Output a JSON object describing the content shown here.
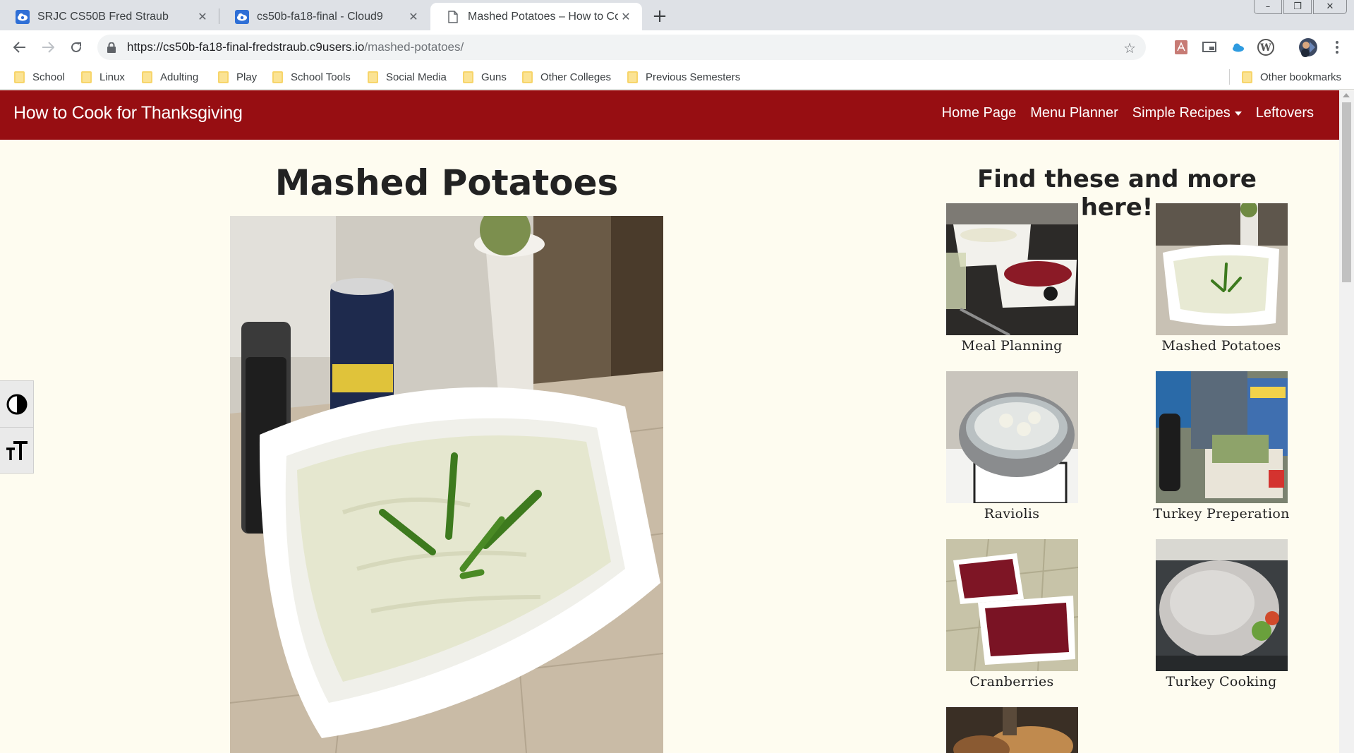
{
  "browser": {
    "tabs": [
      {
        "title": "SRJC CS50B Fred Straub",
        "icon": "cloud9-icon"
      },
      {
        "title": "cs50b-fa18-final - Cloud9",
        "icon": "cloud9-icon"
      },
      {
        "title": "Mashed Potatoes – How to Cook",
        "icon": "document-icon"
      }
    ],
    "url_host": "https://cs50b-fa18-final-fredstraub.c9users.io",
    "url_path": "/mashed-potatoes/",
    "bookmarks": [
      "School",
      "Linux",
      "Adulting",
      "Play",
      "School Tools",
      "Social Media",
      "Guns",
      "Other Colleges",
      "Previous Semesters"
    ],
    "other_bookmarks": "Other bookmarks"
  },
  "site": {
    "brand": "How to Cook for Thanksgiving",
    "nav": {
      "home": "Home Page",
      "menu_planner": "Menu Planner",
      "simple_recipes": "Simple Recipes",
      "leftovers": "Leftovers"
    },
    "accent_color": "#970e12",
    "background_color": "#fefcf0"
  },
  "main": {
    "title": "Mashed Potatoes"
  },
  "sidebar": {
    "title": "Find these and more here!",
    "items": [
      {
        "label": "Meal Planning"
      },
      {
        "label": "Mashed Potatoes"
      },
      {
        "label": "Raviolis"
      },
      {
        "label": "Turkey Preperation"
      },
      {
        "label": "Cranberries"
      },
      {
        "label": "Turkey Cooking"
      }
    ]
  }
}
